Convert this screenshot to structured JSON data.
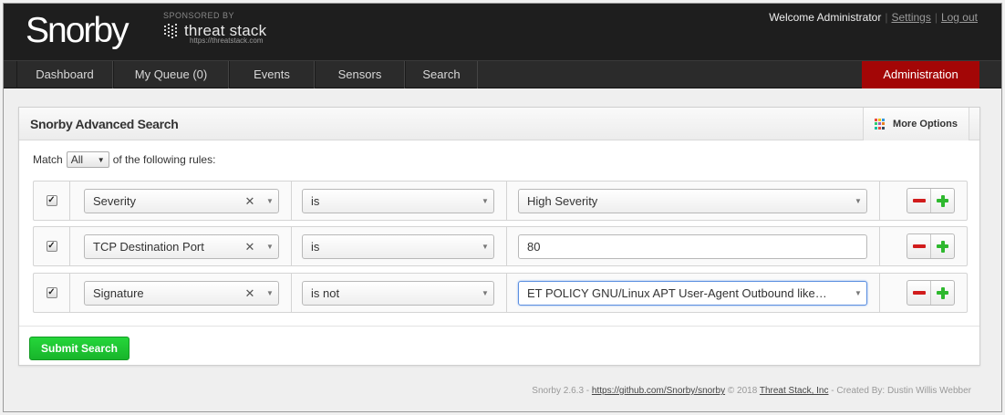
{
  "header": {
    "logo": "Snorby",
    "sponsor_label": "SPONSORED BY",
    "sponsor_name": "threat stack",
    "sponsor_url": "https://threatstack.com",
    "welcome": "Welcome Administrator",
    "settings": "Settings",
    "logout": "Log out"
  },
  "nav": {
    "items": [
      "Dashboard",
      "My Queue (0)",
      "Events",
      "Sensors",
      "Search"
    ],
    "admin": "Administration"
  },
  "panel": {
    "title": "Snorby Advanced Search",
    "more_options": "More Options",
    "match_prefix": "Match",
    "match_value": "All",
    "match_suffix": "of the following rules:",
    "rules": [
      {
        "field": "Severity",
        "operator": "is",
        "value": "High Severity",
        "value_type": "select",
        "checked": true
      },
      {
        "field": "TCP Destination Port",
        "operator": "is",
        "value": "80",
        "value_type": "input",
        "checked": true
      },
      {
        "field": "Signature",
        "operator": "is not",
        "value": "ET POLICY GNU/Linux APT User-Agent Outbound like…",
        "value_type": "select",
        "checked": true
      }
    ],
    "submit": "Submit Search"
  },
  "footer": {
    "version": "Snorby 2.6.3 -",
    "repo": "https://github.com/Snorby/snorby",
    "copyright": "© 2018",
    "company": "Threat Stack, Inc",
    "credit": "- Created By: Dustin Willis Webber"
  },
  "colors": {
    "admin_bg": "#a30606",
    "submit_green": "#1ec732",
    "minus_red": "#d11c1c",
    "plus_green": "#2eb82e"
  },
  "icons": {
    "more_options": "grid-icon",
    "remove": "minus-icon",
    "add": "plus-icon",
    "clear": "close-icon",
    "dropdown": "chevron-down-icon",
    "check": "checkbox-icon"
  }
}
